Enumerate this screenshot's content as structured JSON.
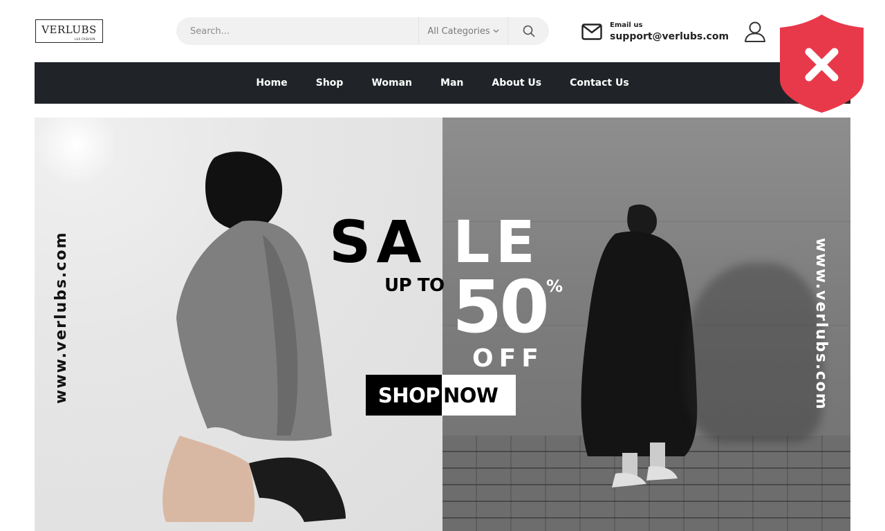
{
  "header": {
    "logo": {
      "name": "VERLUBS",
      "tagline": "LUX FASHION"
    },
    "search": {
      "placeholder": "Search...",
      "category_selected": "All Categories",
      "category_icon": "chevron-down-icon",
      "button_icon": "search-icon"
    },
    "contact": {
      "icon": "envelope-icon",
      "label": "Email us",
      "email": "support@verlubs.com"
    },
    "account_icon": "user-icon"
  },
  "overlay": {
    "icon": "shield-x-icon",
    "color": "#e8394a"
  },
  "nav": {
    "items": [
      {
        "label": "Home"
      },
      {
        "label": "Shop"
      },
      {
        "label": "Woman"
      },
      {
        "label": "Man"
      },
      {
        "label": "About Us"
      },
      {
        "label": "Contact Us"
      }
    ]
  },
  "banner": {
    "side_text_left": "www.verlubs.com",
    "side_text_right": "www.verlubs.com",
    "sale_left": "SA",
    "sale_right": "LE",
    "up_to": "UP TO",
    "amount": "50",
    "percent": "%",
    "off": "OFF",
    "cta_shop": "SHOP",
    "cta_now": "NOW"
  },
  "colors": {
    "nav_bg": "#202428",
    "search_bg": "#f1f1f1",
    "text_dark": "#222222"
  }
}
